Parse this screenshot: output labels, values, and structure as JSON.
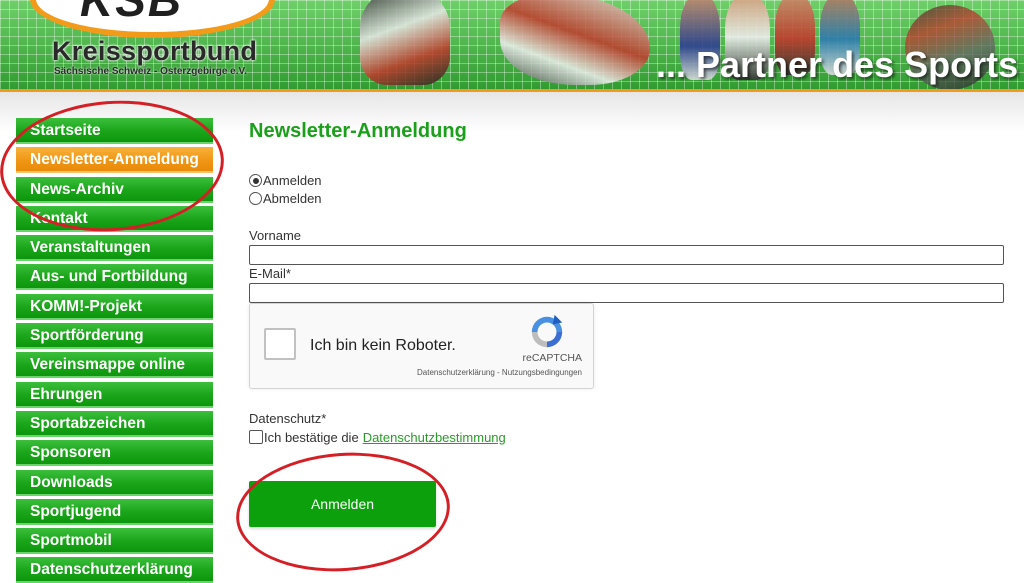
{
  "header": {
    "logo_mark": "KSB",
    "logo_title": "Kreissportbund",
    "logo_subtitle": "Sächsische Schweiz - Osterzgebirge e.V.",
    "slogan": "... Partner des Sports",
    "colors": {
      "grid_green": "#3aa83a",
      "accent_orange": "#f29a1a"
    }
  },
  "sidebar": {
    "active_index": 1,
    "items": [
      {
        "label": "Startseite"
      },
      {
        "label": "Newsletter-Anmeldung"
      },
      {
        "label": "News-Archiv"
      },
      {
        "label": "Kontakt"
      },
      {
        "label": "Veranstaltungen"
      },
      {
        "label": "Aus- und Fortbildung"
      },
      {
        "label": "KOMM!-Projekt"
      },
      {
        "label": "Sportförderung"
      },
      {
        "label": "Vereinsmappe online"
      },
      {
        "label": "Ehrungen"
      },
      {
        "label": "Sportabzeichen"
      },
      {
        "label": "Sponsoren"
      },
      {
        "label": "Downloads"
      },
      {
        "label": "Sportjugend"
      },
      {
        "label": "Sportmobil"
      },
      {
        "label": "Datenschutzerklärung"
      }
    ]
  },
  "main": {
    "title": "Newsletter-Anmeldung",
    "radio_options": [
      {
        "label": "Anmelden",
        "checked": true
      },
      {
        "label": "Abmelden",
        "checked": false
      }
    ],
    "fields": {
      "vorname_label": "Vorname",
      "vorname_value": "",
      "email_label": "E-Mail*",
      "email_value": ""
    },
    "recaptcha": {
      "label": "Ich bin kein Roboter.",
      "brand": "reCAPTCHA",
      "terms": "Datenschutzerklärung - Nutzungsbedingungen"
    },
    "privacy": {
      "label": "Datenschutz*",
      "checkbox_text": "Ich bestätige die",
      "link_text": "Datenschutzbestimmung"
    },
    "submit_label": "Anmelden",
    "colors": {
      "title_green": "#1aa01a",
      "button_green": "#0ca10c",
      "active_orange": "#f09414",
      "annotation_red": "#d51f26"
    }
  }
}
